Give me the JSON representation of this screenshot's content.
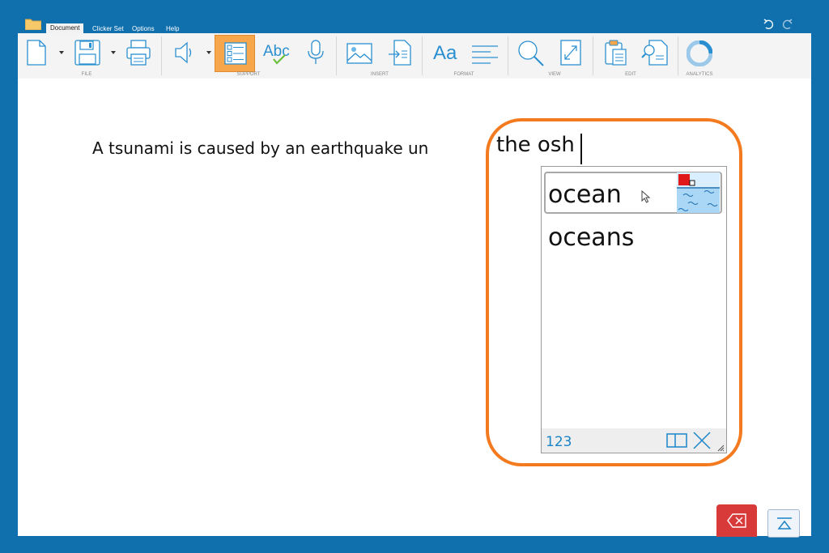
{
  "menu": {
    "tabs": [
      "Document",
      "Clicker Set",
      "Options",
      "Help"
    ],
    "active_tab": "Document"
  },
  "ribbon": {
    "groups": [
      "FILE",
      "SUPPORT",
      "INSERT",
      "FORMAT",
      "VIEW",
      "EDIT",
      "ANALYTICS"
    ],
    "format_button_label": "Aa",
    "spellcheck_label": "Abc",
    "active_button": "word-prediction"
  },
  "document": {
    "sentence": "A tsunami is caused by an earthquake un",
    "typed_text": "the osh"
  },
  "prediction": {
    "items": [
      "ocean",
      "oceans"
    ],
    "numbers_label": "123",
    "accent_color": "#f47a20"
  },
  "colors": {
    "frame": "#0f70ad",
    "ribbon": "#f4f4f4",
    "icon_blue": "#2a8fd0",
    "active_button": "#f7a64b",
    "delete_button": "#d83a3a"
  },
  "icons": [
    "folder-icon",
    "undo-icon",
    "redo-icon",
    "new-document-icon",
    "save-icon",
    "print-icon",
    "speaker-icon",
    "word-prediction-icon",
    "spellcheck-icon",
    "microphone-icon",
    "picture-icon",
    "insert-file-icon",
    "format-icon",
    "paragraph-icon",
    "zoom-icon",
    "page-size-icon",
    "paste-icon",
    "find-icon",
    "analytics-icon",
    "pointer-icon",
    "ocean-symbol-icon",
    "split-icon",
    "close-icon",
    "resize-grip-icon",
    "backspace-icon",
    "collapse-icon"
  ]
}
